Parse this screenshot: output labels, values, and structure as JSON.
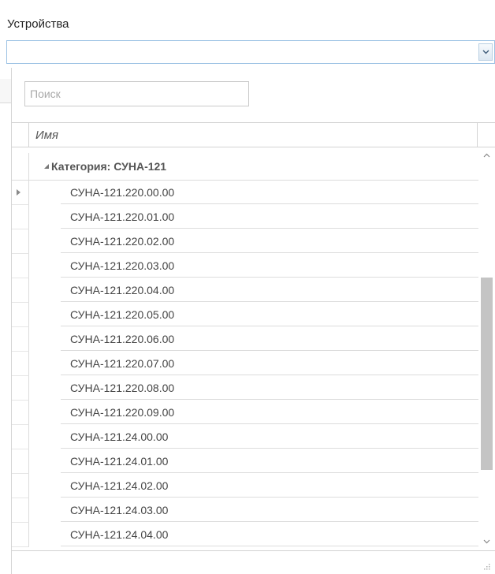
{
  "field": {
    "label": "Устройства",
    "value": ""
  },
  "search": {
    "placeholder": "Поиск",
    "value": ""
  },
  "grid": {
    "column_header": "Имя",
    "group_caption": "Категория: СУНА-121",
    "rows": [
      "СУНА-121.220.00.00",
      "СУНА-121.220.01.00",
      "СУНА-121.220.02.00",
      "СУНА-121.220.03.00",
      "СУНА-121.220.04.00",
      "СУНА-121.220.05.00",
      "СУНА-121.220.06.00",
      "СУНА-121.220.07.00",
      "СУНА-121.220.08.00",
      "СУНА-121.220.09.00",
      "СУНА-121.24.00.00",
      "СУНА-121.24.01.00",
      "СУНА-121.24.02.00",
      "СУНА-121.24.03.00",
      "СУНА-121.24.04.00"
    ]
  },
  "colors": {
    "combo_border": "#9dc3e4",
    "grid_line": "#dcdcdc",
    "scroll_thumb": "#c4c4c4"
  },
  "icons": {
    "dropdown": "chevron-down-icon",
    "group_toggle": "triangle-collapse-icon",
    "row_indicator": "triangle-right-icon",
    "scroll_up": "chevron-up-icon",
    "scroll_down": "chevron-down-icon",
    "resize": "resize-grip-icon"
  }
}
